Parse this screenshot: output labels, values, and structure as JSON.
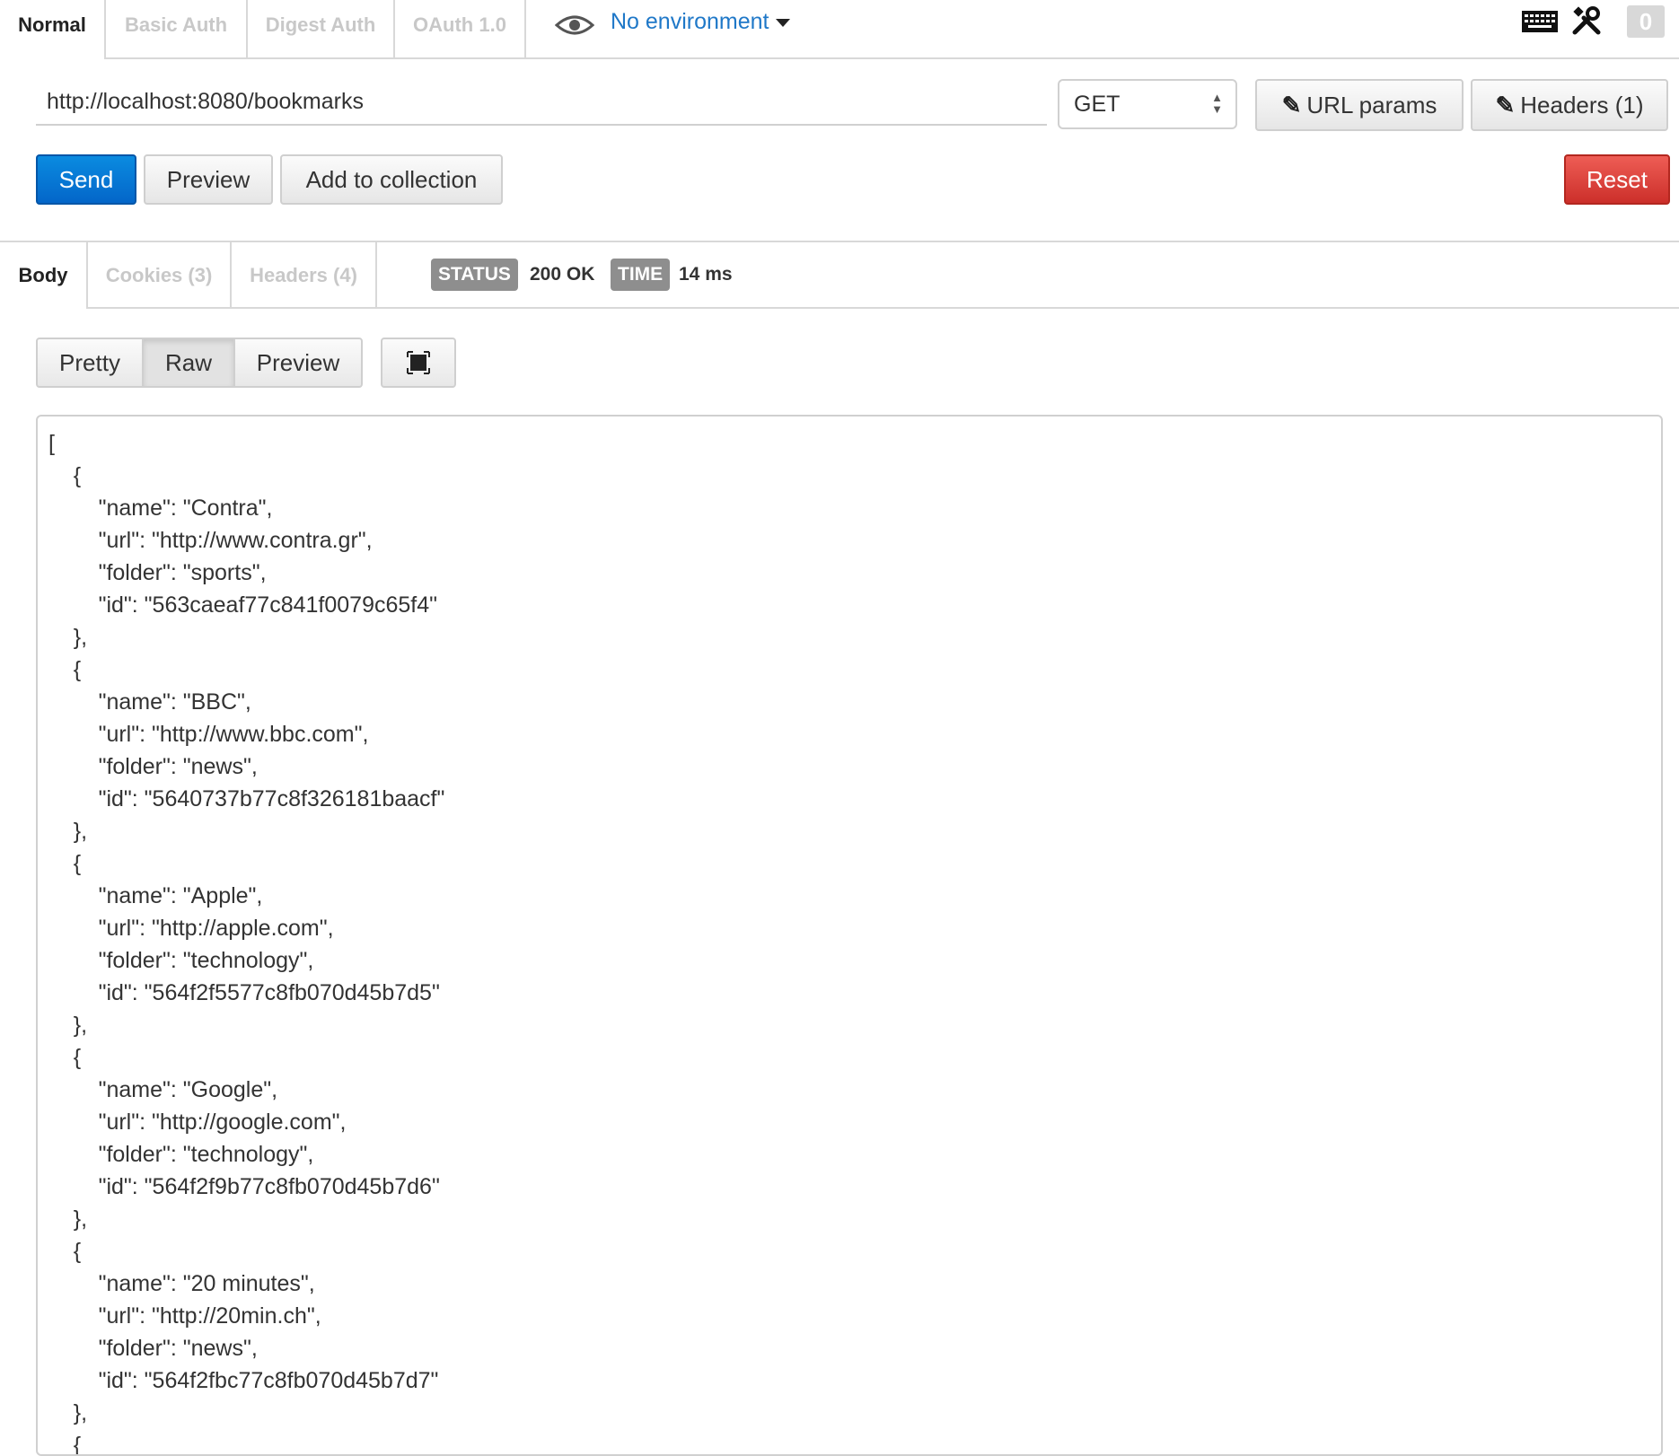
{
  "auth_tabs": [
    "Normal",
    "Basic Auth",
    "Digest Auth",
    "OAuth 1.0"
  ],
  "environment": {
    "label": "No environment"
  },
  "toolbar_icons": [
    "keyboard-icon",
    "wrench-icon"
  ],
  "counter": "0",
  "request": {
    "url": "http://localhost:8080/bookmarks",
    "method": "GET",
    "url_params_label": "URL params",
    "headers_label": "Headers (1)"
  },
  "actions": {
    "send": "Send",
    "preview": "Preview",
    "add_to_collection": "Add to collection",
    "reset": "Reset"
  },
  "response_tabs": [
    "Body",
    "Cookies (3)",
    "Headers (4)"
  ],
  "status": {
    "status_label": "STATUS",
    "status_value": "200 OK",
    "time_label": "TIME",
    "time_value": "14 ms"
  },
  "view_modes": [
    "Pretty",
    "Raw",
    "Preview"
  ],
  "active_view_mode": "Raw",
  "colors": {
    "accent_link": "#1f78c8",
    "send": "#0466c9",
    "reset": "#cc2f2a",
    "chip": "#8e8e8e"
  },
  "body_lines": [
    "[",
    "    {",
    "        \"name\": \"Contra\",",
    "        \"url\": \"http://www.contra.gr\",",
    "        \"folder\": \"sports\",",
    "        \"id\": \"563caeaf77c841f0079c65f4\"",
    "    },",
    "    {",
    "        \"name\": \"BBC\",",
    "        \"url\": \"http://www.bbc.com\",",
    "        \"folder\": \"news\",",
    "        \"id\": \"5640737b77c8f326181baacf\"",
    "    },",
    "    {",
    "        \"name\": \"Apple\",",
    "        \"url\": \"http://apple.com\",",
    "        \"folder\": \"technology\",",
    "        \"id\": \"564f2f5577c8fb070d45b7d5\"",
    "    },",
    "    {",
    "        \"name\": \"Google\",",
    "        \"url\": \"http://google.com\",",
    "        \"folder\": \"technology\",",
    "        \"id\": \"564f2f9b77c8fb070d45b7d6\"",
    "    },",
    "    {",
    "        \"name\": \"20 minutes\",",
    "        \"url\": \"http://20min.ch\",",
    "        \"folder\": \"news\",",
    "        \"id\": \"564f2fbc77c8fb070d45b7d7\"",
    "    },",
    "    {"
  ]
}
